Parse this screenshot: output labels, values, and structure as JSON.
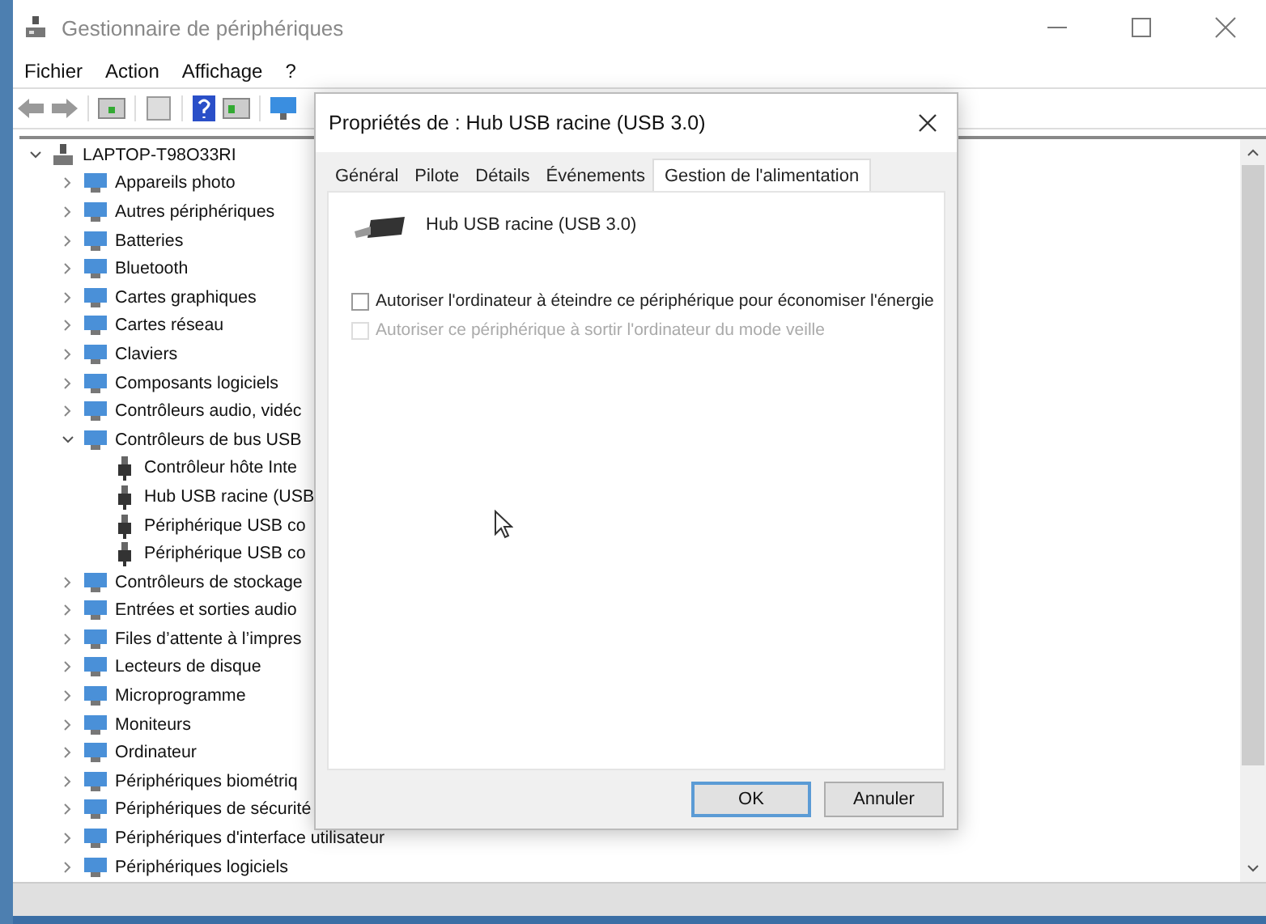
{
  "window": {
    "title": "Gestionnaire de périphériques"
  },
  "menu": [
    "Fichier",
    "Action",
    "Affichage",
    "?"
  ],
  "tree": {
    "label": "LAPTOP-T98O33RI",
    "expanded": true,
    "children": [
      {
        "label": "Appareils photo",
        "expanded": false
      },
      {
        "label": "Autres périphériques",
        "expanded": false
      },
      {
        "label": "Batteries",
        "expanded": false
      },
      {
        "label": "Bluetooth",
        "expanded": false
      },
      {
        "label": "Cartes graphiques",
        "expanded": false
      },
      {
        "label": "Cartes réseau",
        "expanded": false
      },
      {
        "label": "Claviers",
        "expanded": false
      },
      {
        "label": "Composants logiciels",
        "expanded": false
      },
      {
        "label": "Contrôleurs audio, vidéc",
        "expanded": false
      },
      {
        "label": "Contrôleurs de bus USB",
        "expanded": true,
        "children": [
          {
            "label": "Contrôleur hôte Inte"
          },
          {
            "label": "Hub USB racine (USB"
          },
          {
            "label": "Périphérique USB co"
          },
          {
            "label": "Périphérique USB co"
          }
        ]
      },
      {
        "label": "Contrôleurs de stockage",
        "expanded": false
      },
      {
        "label": "Entrées et sorties audio",
        "expanded": false
      },
      {
        "label": "Files d’attente à l’impres",
        "expanded": false
      },
      {
        "label": "Lecteurs de disque",
        "expanded": false
      },
      {
        "label": "Microprogramme",
        "expanded": false
      },
      {
        "label": "Moniteurs",
        "expanded": false
      },
      {
        "label": "Ordinateur",
        "expanded": false
      },
      {
        "label": "Périphériques biométriq",
        "expanded": false
      },
      {
        "label": "Périphériques de sécurité",
        "expanded": false
      },
      {
        "label": "Périphériques d'interface utilisateur",
        "expanded": false
      },
      {
        "label": "Périphériques logiciels",
        "expanded": false
      }
    ]
  },
  "dialog": {
    "title": "Propriétés de : Hub USB racine (USB 3.0)",
    "tabs": [
      {
        "label": "Général",
        "selected": false
      },
      {
        "label": "Pilote",
        "selected": false
      },
      {
        "label": "Détails",
        "selected": false
      },
      {
        "label": "Événements",
        "selected": false
      },
      {
        "label": "Gestion de l'alimentation",
        "selected": true
      }
    ],
    "device_name": "Hub USB racine (USB 3.0)",
    "options": [
      {
        "label": "Autoriser l'ordinateur à éteindre ce périphérique pour économiser l'énergie",
        "checked": false,
        "disabled": false
      },
      {
        "label": "Autoriser ce périphérique à sortir l'ordinateur du mode veille",
        "checked": false,
        "disabled": true
      }
    ],
    "buttons": [
      {
        "label": "OK",
        "default": true
      },
      {
        "label": "Annuler",
        "default": false
      }
    ]
  }
}
